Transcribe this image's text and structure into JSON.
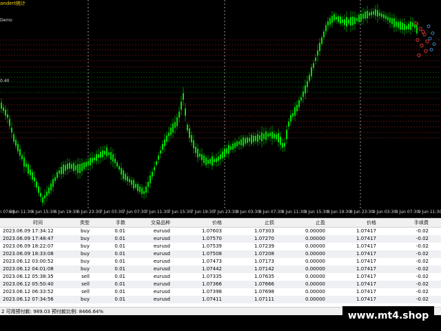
{
  "chart": {
    "title": "andert统计",
    "sub_label": "Demo",
    "side_label": "0:40",
    "x_ticks": [
      "n 07:30",
      "6 Jun 11:30",
      "6 Jun 15:30",
      "6 Jun 19:30",
      "6 Jun 23:30",
      "7 Jun 03:30",
      "7 Jun 07:30",
      "7 Jun 11:30",
      "7 Jun 15:30",
      "7 Jun 19:30",
      "7 Jun 23:30",
      "8 Jun 03:30",
      "8 Jun 07:30",
      "8 Jun 11:30",
      "8 Jun 15:30",
      "8 Jun 19:30",
      "8 Jun 23:30",
      "9 Jun 03:30",
      "9 Jun 07:30",
      "9 Jun 11:30"
    ],
    "colors": {
      "candle": "#00e000",
      "grid": "#ffffff",
      "level_red": "#ff3030",
      "level_green": "#00d000"
    }
  },
  "table": {
    "headers": [
      "时间",
      "类型",
      "手数",
      "交易品种",
      "价格",
      "止损",
      "止盈",
      "价格",
      "手续费"
    ],
    "rows": [
      [
        "2023.06.09 17:34:12",
        "buy",
        "0.01",
        "eurusd",
        "1.07603",
        "1.07303",
        "0.00000",
        "1.07417",
        "-0.02"
      ],
      [
        "2023.06.09 17:48:47",
        "buy",
        "0.01",
        "eurusd",
        "1.07570",
        "1.07270",
        "0.00000",
        "1.07417",
        "-0.02"
      ],
      [
        "2023.06.09 18:22:07",
        "buy",
        "0.01",
        "eurusd",
        "1.07539",
        "1.07239",
        "0.00000",
        "1.07417",
        "-0.02"
      ],
      [
        "2023.06.09 18:33:08",
        "buy",
        "0.01",
        "eurusd",
        "1.07508",
        "1.07208",
        "0.00000",
        "1.07417",
        "-0.02"
      ],
      [
        "2023.06.12 03:00:52",
        "buy",
        "0.01",
        "eurusd",
        "1.07473",
        "1.07173",
        "0.00000",
        "1.07417",
        "-0.02"
      ],
      [
        "2023.06.12 04:01:08",
        "buy",
        "0.01",
        "eurusd",
        "1.07442",
        "1.07142",
        "0.00000",
        "1.07417",
        "-0.02"
      ],
      [
        "2023.06.12 05:38:35",
        "sell",
        "0.01",
        "eurusd",
        "1.07335",
        "1.07635",
        "0.00000",
        "1.07417",
        "-0.02"
      ],
      [
        "2023.06.12 05:50:40",
        "sell",
        "0.01",
        "eurusd",
        "1.07366",
        "1.07666",
        "0.00000",
        "1.07417",
        "-0.02"
      ],
      [
        "2023.06.12 06:33:52",
        "sell",
        "0.01",
        "eurusd",
        "1.07398",
        "1.07698",
        "0.00000",
        "1.07417",
        "-0.02"
      ],
      [
        "2023.06.12 07:34:56",
        "buy",
        "0.01",
        "eurusd",
        "1.07411",
        "1.07111",
        "0.00000",
        "1.07417",
        "-0.02"
      ]
    ]
  },
  "status": {
    "text": "2  可用预付款: 989.03  预付款比例: 8466.64%"
  },
  "watermark": "www.mt4.shop"
}
